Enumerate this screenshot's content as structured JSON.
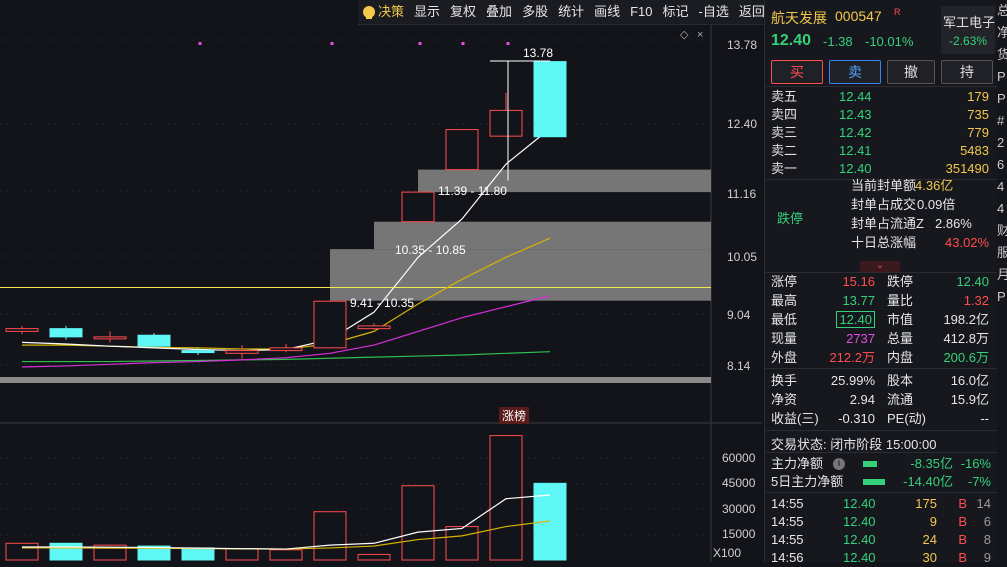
{
  "toolbar": {
    "items": [
      "决策",
      "显示",
      "复权",
      "叠加",
      "多股",
      "统计",
      "画线",
      "F10",
      "标记",
      "-自选",
      "返回"
    ]
  },
  "stock": {
    "name": "航天发展",
    "code": "000547",
    "badge": "R",
    "price": "12.40",
    "change": "-1.38",
    "change_pct": "-10.01%",
    "sector_name": "军工电子",
    "sector_change": "-2.63%"
  },
  "actions": {
    "buy": "买",
    "sell": "卖",
    "cancel": "撤",
    "hold": "持"
  },
  "order_book": [
    {
      "label": "卖五",
      "price": "12.44",
      "vol": "179"
    },
    {
      "label": "卖四",
      "price": "12.43",
      "vol": "735"
    },
    {
      "label": "卖三",
      "price": "12.42",
      "vol": "779"
    },
    {
      "label": "卖二",
      "price": "12.41",
      "vol": "5483"
    },
    {
      "label": "卖一",
      "price": "12.40",
      "vol": "351490"
    }
  ],
  "limit_info": {
    "status": "跌停",
    "items": [
      {
        "label": "当前封单额",
        "value": "4.36亿"
      },
      {
        "label": "封单占成交",
        "value": "0.09倍"
      },
      {
        "label": "封单占流通Z",
        "value": "2.86%"
      },
      {
        "label": "十日总涨幅",
        "value": "43.02%"
      }
    ]
  },
  "stats": {
    "zhangting": {
      "label": "涨停",
      "value": "15.16"
    },
    "dieting": {
      "label": "跌停",
      "value": "12.40"
    },
    "zuigao": {
      "label": "最高",
      "value": "13.77"
    },
    "liangbi": {
      "label": "量比",
      "value": "1.32"
    },
    "zuidi": {
      "label": "最低",
      "value": "12.40"
    },
    "shizhi": {
      "label": "市值",
      "value": "198.2亿"
    },
    "xianliang": {
      "label": "现量",
      "value": "2737"
    },
    "zongliang": {
      "label": "总量",
      "value": "412.8万"
    },
    "waipan": {
      "label": "外盘",
      "value": "212.2万"
    },
    "neipan": {
      "label": "内盘",
      "value": "200.6万"
    },
    "huanshou": {
      "label": "换手",
      "value": "25.99%"
    },
    "guben": {
      "label": "股本",
      "value": "16.0亿"
    },
    "jingzi": {
      "label": "净资",
      "value": "2.94"
    },
    "liutong": {
      "label": "流通",
      "value": "15.9亿"
    },
    "shouyi": {
      "label": "收益(三)",
      "value": "-0.310"
    },
    "pe": {
      "label": "PE(动)",
      "value": "--"
    }
  },
  "trade_status": "交易状态: 闭市阶段 15:00:00",
  "fund_flow": [
    {
      "label": "主力净额",
      "value": "-8.35亿",
      "pct": "-16%"
    },
    {
      "label": "5日主力净额",
      "value": "-14.40亿",
      "pct": "-7%"
    }
  ],
  "ticks": [
    {
      "time": "14:55",
      "price": "12.40",
      "vol": "175",
      "side": "B",
      "num": "14"
    },
    {
      "time": "14:55",
      "price": "12.40",
      "vol": "9",
      "side": "B",
      "num": "6"
    },
    {
      "time": "14:55",
      "price": "12.40",
      "vol": "24",
      "side": "B",
      "num": "8"
    },
    {
      "time": "14:56",
      "price": "12.40",
      "vol": "30",
      "side": "B",
      "num": "9"
    }
  ],
  "far_right_chars": [
    "总",
    "净",
    "货",
    "",
    "P",
    "P",
    "#",
    "2",
    "6",
    "4",
    "4",
    "财",
    "服",
    "月",
    "P"
  ],
  "chart_labels": {
    "price_axis": [
      "13.78",
      "12.40",
      "11.16",
      "10.05",
      "9.04",
      "8.14"
    ],
    "volume_axis": [
      "60000",
      "45000",
      "30000",
      "15000"
    ],
    "volume_unit": "X100",
    "zone_labels": [
      "11.39 - 11.80",
      "10.35 - 10.85",
      "9.41 - 10.35"
    ],
    "high_label": "13.78",
    "tag": "涨榜"
  },
  "chart_data": {
    "type": "candlestick",
    "candles": [
      {
        "o": 8.85,
        "c": 8.9,
        "h": 8.95,
        "l": 8.8,
        "vol": 9000
      },
      {
        "o": 8.9,
        "c": 8.75,
        "h": 8.95,
        "l": 8.7,
        "vol": 9000
      },
      {
        "o": 8.72,
        "c": 8.75,
        "h": 8.85,
        "l": 8.65,
        "vol": 8000
      },
      {
        "o": 8.78,
        "c": 8.58,
        "h": 8.82,
        "l": 8.55,
        "vol": 7500
      },
      {
        "o": 8.5,
        "c": 8.49,
        "h": 8.56,
        "l": 8.42,
        "vol": 6500
      },
      {
        "o": 8.45,
        "c": 8.5,
        "h": 8.6,
        "l": 8.35,
        "vol": 6000
      },
      {
        "o": 8.5,
        "c": 8.55,
        "h": 8.62,
        "l": 8.47,
        "vol": 5500
      },
      {
        "o": 8.55,
        "c": 9.4,
        "h": 9.41,
        "l": 8.55,
        "vol": 26000
      },
      {
        "o": 8.9,
        "c": 8.95,
        "h": 9.0,
        "l": 8.88,
        "vol": 3000
      },
      {
        "o": 10.85,
        "c": 11.39,
        "h": 11.39,
        "l": 10.85,
        "vol": 40000
      },
      {
        "o": 11.8,
        "c": 12.53,
        "h": 12.53,
        "l": 11.8,
        "vol": 18000
      },
      {
        "o": 12.41,
        "c": 12.88,
        "h": 13.2,
        "l": 12.41,
        "vol": 67000
      },
      {
        "o": 13.77,
        "c": 12.4,
        "h": 13.78,
        "l": 12.4,
        "vol": 41281
      }
    ],
    "ma_white": [
      8.65,
      8.62,
      8.58,
      8.55,
      8.52,
      8.5,
      8.52,
      8.7,
      9.2,
      10.2,
      10.9,
      11.9,
      12.55
    ],
    "ma_yellow": [
      8.6,
      8.6,
      8.58,
      8.56,
      8.55,
      8.53,
      8.53,
      8.62,
      8.85,
      9.35,
      9.8,
      10.2,
      10.55
    ],
    "ma_magenta": [
      8.2,
      8.22,
      8.25,
      8.28,
      8.3,
      8.33,
      8.37,
      8.45,
      8.6,
      8.85,
      9.1,
      9.3,
      9.5
    ],
    "ma_green": [
      8.3,
      8.3,
      8.3,
      8.31,
      8.32,
      8.33,
      8.34,
      8.36,
      8.38,
      8.4,
      8.42,
      8.45,
      8.48
    ],
    "gaps": [
      {
        "low": 11.39,
        "high": 11.8,
        "start": 9
      },
      {
        "low": 10.35,
        "high": 10.85,
        "start": 8
      },
      {
        "low": 9.41,
        "high": 10.35,
        "start": 7
      }
    ],
    "yellow_level": 9.65,
    "price_range": [
      8.0,
      14.2
    ],
    "vol_max": 70000,
    "vol_ma_white": [
      7000,
      7000,
      6900,
      6700,
      6400,
      6100,
      5900,
      8000,
      9000,
      15000,
      17000,
      33000,
      35000
    ],
    "vol_ma_yellow": [
      6500,
      6500,
      6400,
      6300,
      6200,
      6000,
      5900,
      6500,
      7500,
      11000,
      13000,
      18000,
      21000
    ]
  }
}
